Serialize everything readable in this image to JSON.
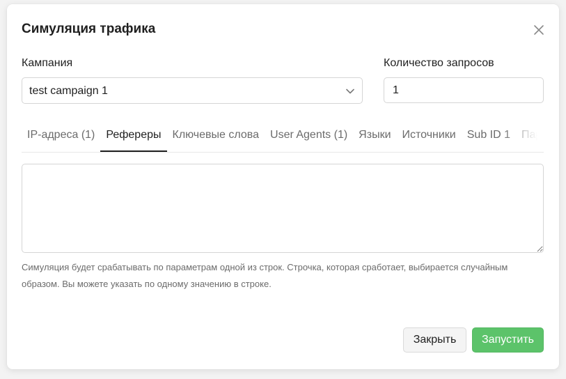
{
  "dialog": {
    "title": "Симуляция трафика"
  },
  "campaign": {
    "label": "Кампания",
    "value": "test campaign 1"
  },
  "request_count": {
    "label": "Количество запросов",
    "value": "1"
  },
  "tabs": [
    {
      "label": "IP-адреса (1)",
      "active": false
    },
    {
      "label": "Рефереры",
      "active": true
    },
    {
      "label": "Ключевые слова",
      "active": false
    },
    {
      "label": "User Agents (1)",
      "active": false
    },
    {
      "label": "Языки",
      "active": false
    },
    {
      "label": "Источники",
      "active": false
    },
    {
      "label": "Sub ID 1",
      "active": false
    },
    {
      "label": "Пар",
      "active": false
    }
  ],
  "textarea": {
    "value": ""
  },
  "help_text": "Симуляция будет срабатывать по параметрам одной из строк. Строчка, которая сработает, выбирается случайным образом. Вы можете указать по одному значению в строке.",
  "buttons": {
    "close_label": "Закрыть",
    "run_label": "Запустить"
  },
  "colors": {
    "primary": "#5cc36a",
    "text": "#1f1f1f",
    "muted": "#6b6b6b",
    "border": "#d5d5d5"
  },
  "icons": {
    "close": "close-icon",
    "select_arrow": "chevron-down-icon"
  }
}
